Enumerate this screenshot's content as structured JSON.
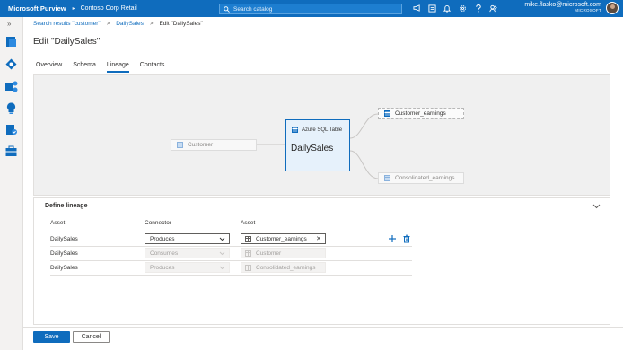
{
  "topbar": {
    "brand": "Microsoft Purview",
    "tenant": "Contoso Corp Retail",
    "search_placeholder": "Search catalog",
    "icons": [
      "announcement-icon",
      "switch-directory-icon",
      "notifications-icon",
      "settings-icon",
      "help-icon",
      "feedback-icon"
    ],
    "user_email": "mike.flasko@microsoft.com",
    "user_org": "MICROSOFT"
  },
  "leftrail": {
    "expand": "»",
    "icons": [
      "data-catalog-icon",
      "data-map-icon",
      "data-sources-icon",
      "insights-icon",
      "policy-icon",
      "management-icon"
    ]
  },
  "breadcrumb": {
    "items": [
      "Search results \"customer\"",
      "DailySales",
      "Edit \"DailySales\""
    ]
  },
  "page": {
    "title": "Edit \"DailySales\""
  },
  "tabs": [
    "Overview",
    "Schema",
    "Lineage",
    "Contacts"
  ],
  "active_tab": "Lineage",
  "lineage": {
    "source_node": "Customer",
    "main_node_type": "Azure SQL Table",
    "main_node_name": "DailySales",
    "target_node_1": "Customer_earnings",
    "target_node_2": "Consolidated_earnings"
  },
  "define_lineage": {
    "title": "Define lineage",
    "col_asset": "Asset",
    "col_connector": "Connector",
    "col_asset2": "Asset",
    "rows": [
      {
        "asset": "DailySales",
        "connector": "Produces",
        "target": "Customer_earnings",
        "editable": true
      },
      {
        "asset": "DailySales",
        "connector": "Consumes",
        "target": "Customer",
        "editable": false
      },
      {
        "asset": "DailySales",
        "connector": "Produces",
        "target": "Consolidated_earnings",
        "editable": false
      }
    ]
  },
  "footer": {
    "save": "Save",
    "cancel": "Cancel"
  },
  "colors": {
    "brand_blue": "#0f6cbd",
    "canvas_bg": "#f0f0f0",
    "selected_node_bg": "#e6f1fb"
  }
}
